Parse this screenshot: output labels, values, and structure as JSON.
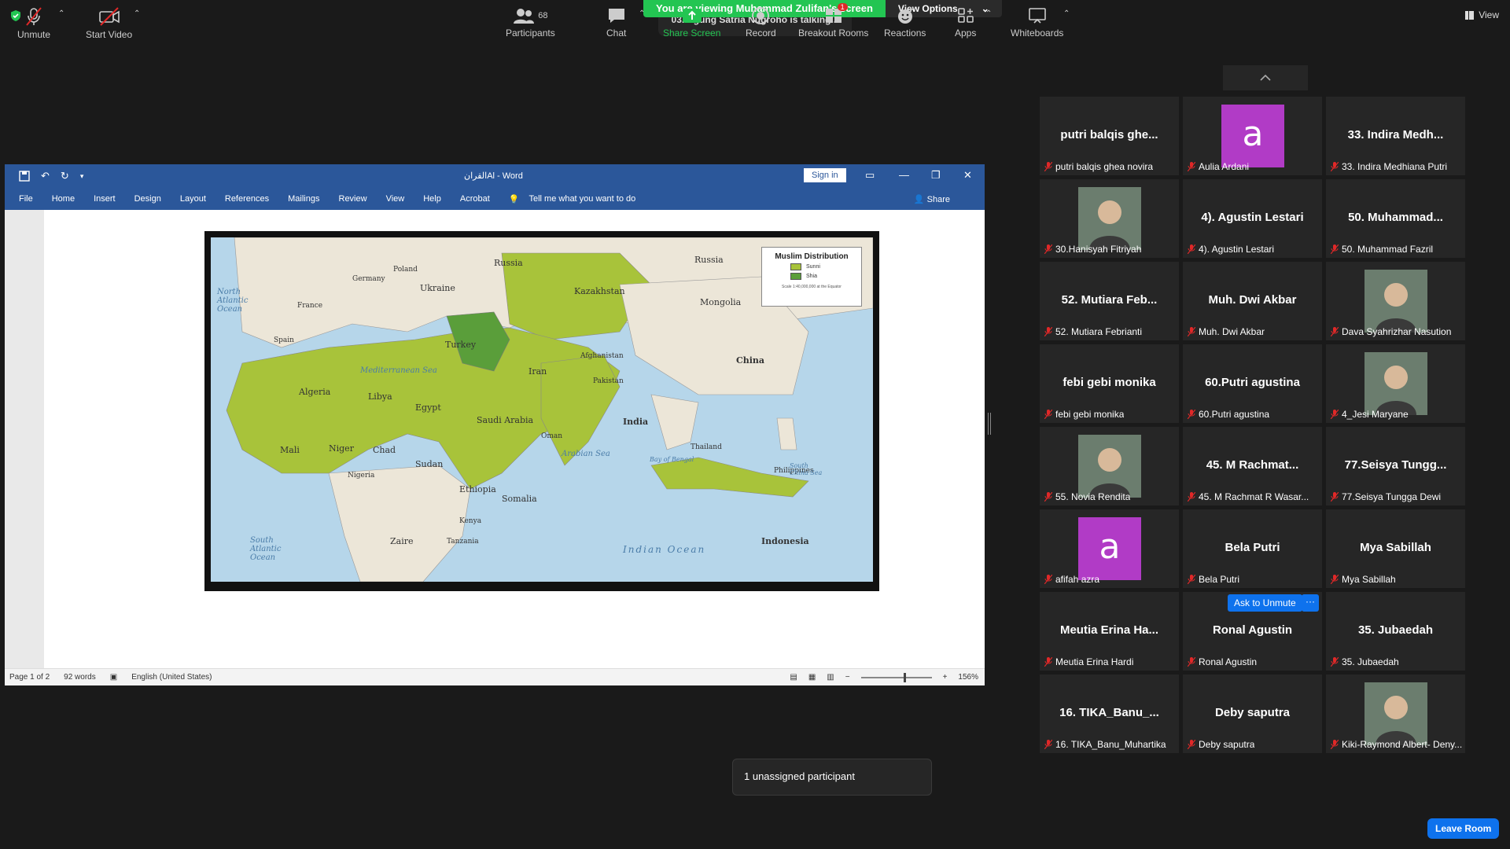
{
  "banner": {
    "share_text": "You are viewing Muhammad Zulifan's screen",
    "view_options": "View Options",
    "talking": "03. Agung Satria Nugroho is talking..."
  },
  "view_top": "View",
  "word": {
    "doc_title": "القرانAl  -  Word",
    "sign_in": "Sign in",
    "menu": [
      "File",
      "Home",
      "Insert",
      "Design",
      "Layout",
      "References",
      "Mailings",
      "Review",
      "View",
      "Help",
      "Acrobat"
    ],
    "tell_me": "Tell me what you want to do",
    "share": "Share",
    "status": {
      "page": "Page 1 of 2",
      "words": "92 words",
      "language": "English (United States)",
      "zoom": "156%"
    }
  },
  "map": {
    "legend_title": "Muslim Distribution",
    "legend_items": [
      "Sunni",
      "Shia"
    ],
    "scale_note": "Scale 1:40,000,000 at the Equator",
    "labels": [
      "Russia",
      "Russia",
      "Ukraine",
      "Kazakhstan",
      "Mongolia",
      "China",
      "Turkey",
      "Iran",
      "Algeria",
      "Libya",
      "Egypt",
      "Saudi Arabia",
      "India",
      "Mali",
      "Niger",
      "Chad",
      "Sudan",
      "Ethiopia",
      "Somalia",
      "Zaire",
      "Indonesia",
      "Thailand",
      "Spain",
      "France",
      "Afghanistan",
      "Pakistan",
      "Oman",
      "Nigeria",
      "Kenya",
      "Tanzania",
      "Philippines",
      "Germany",
      "Poland"
    ],
    "seas": [
      "North Atlantic Ocean",
      "Mediterranean Sea",
      "Arabian Sea",
      "Indian Ocean",
      "South Atlantic Ocean",
      "Bay of Bengal",
      "South China Sea"
    ],
    "colors": {
      "sunni": "#a8c33a",
      "shia": "#5a9e3a",
      "water": "#b6d6ea",
      "land": "#ece6d8"
    }
  },
  "gallery": [
    {
      "big": "putri balqis ghe...",
      "name": "putri balqis ghea novira",
      "type": "text"
    },
    {
      "big": "a",
      "name": "Aulia Ardani",
      "type": "avatar"
    },
    {
      "big": "33. Indira Medh...",
      "name": "33. Indira Medhiana Putri",
      "type": "text"
    },
    {
      "big": "",
      "name": "30.Hanisyah Fitriyah",
      "type": "photo"
    },
    {
      "big": "4). Agustin Lestari",
      "name": "4). Agustin Lestari",
      "type": "text"
    },
    {
      "big": "50. Muhammad...",
      "name": "50. Muhammad Fazril",
      "type": "text"
    },
    {
      "big": "52. Mutiara Feb...",
      "name": "52. Mutiara Febrianti",
      "type": "text"
    },
    {
      "big": "Muh. Dwi Akbar",
      "name": "Muh. Dwi Akbar",
      "type": "text"
    },
    {
      "big": "",
      "name": "Dava Syahrizhar Nasution",
      "type": "photo"
    },
    {
      "big": "febi gebi monika",
      "name": "febi gebi monika",
      "type": "text"
    },
    {
      "big": "60.Putri agustina",
      "name": "60.Putri agustina",
      "type": "text"
    },
    {
      "big": "",
      "name": "4_Jesi Maryane",
      "type": "photo"
    },
    {
      "big": "",
      "name": "55. Novia Rendita",
      "type": "photo"
    },
    {
      "big": "45. M Rachmat...",
      "name": "45. M Rachmat R Wasar...",
      "type": "text"
    },
    {
      "big": "77.Seisya Tungg...",
      "name": "77.Seisya Tungga Dewi",
      "type": "text"
    },
    {
      "big": "a",
      "name": "afifah azra",
      "type": "avatar"
    },
    {
      "big": "Bela Putri",
      "name": "Bela Putri",
      "type": "text"
    },
    {
      "big": "Mya Sabillah",
      "name": "Mya Sabillah",
      "type": "text"
    },
    {
      "big": "Meutia Erina Ha...",
      "name": "Meutia Erina Hardi",
      "type": "text"
    },
    {
      "big": "Ronal Agustin",
      "name": "Ronal Agustin",
      "type": "text"
    },
    {
      "big": "35. Jubaedah",
      "name": "35. Jubaedah",
      "type": "text"
    },
    {
      "big": "16. TIKA_Banu_...",
      "name": "16. TIKA_Banu_Muhartika",
      "type": "text"
    },
    {
      "big": "Deby saputra",
      "name": "Deby saputra",
      "type": "text"
    },
    {
      "big": "",
      "name": "Kiki-Raymond Albert- Deny...",
      "type": "photo"
    }
  ],
  "ask_to_unmute": "Ask to Unmute",
  "more": "···",
  "notice": "1 unassigned participant",
  "toolbar": {
    "unmute": "Unmute",
    "start_video": "Start Video",
    "participants": "Participants",
    "participants_count": "68",
    "chat": "Chat",
    "share_screen": "Share Screen",
    "record": "Record",
    "breakout": "Breakout Rooms",
    "breakout_badge": "1",
    "reactions": "Reactions",
    "apps": "Apps",
    "whiteboards": "Whiteboards",
    "leave": "Leave Room"
  }
}
